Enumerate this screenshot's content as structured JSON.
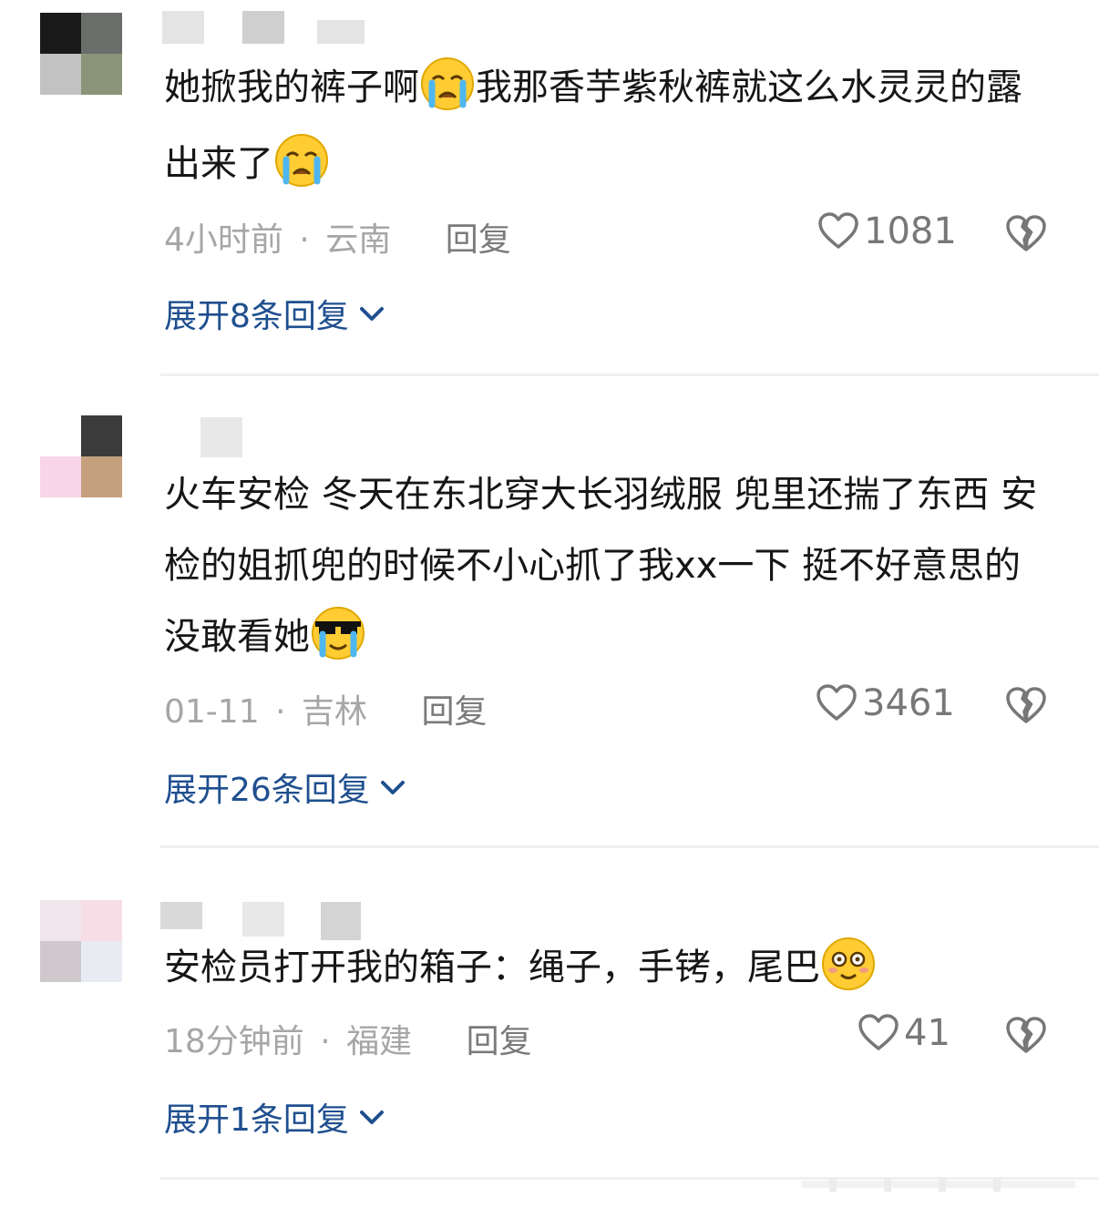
{
  "comments": [
    {
      "text_a": "她掀我的裤子啊",
      "text_b": "我那香芋紫秋裤就这么水灵灵的露出来了",
      "emoji_1": "loudly-crying-face",
      "emoji_2": "loudly-crying-face",
      "time": "4小时前",
      "sep": "·",
      "location": "云南",
      "reply_label": "回复",
      "likes": "1081",
      "expand_label": "展开8条回复"
    },
    {
      "text_a": "火车安检 冬天在东北穿大长羽绒服 兜里还揣了东西 安检的姐抓兜的时候不小心抓了我xx一下 挺不好意思的 没敢看她",
      "emoji_1": "sunglasses-crying-face",
      "time": "01-11",
      "sep": "·",
      "location": "吉林",
      "reply_label": "回复",
      "likes": "3461",
      "expand_label": "展开26条回复"
    },
    {
      "text_a": "安检员打开我的箱子：绳子，手铐，尾巴",
      "emoji_1": "flushed-smiling-face",
      "time": "18分钟前",
      "sep": "·",
      "location": "福建",
      "reply_label": "回复",
      "likes": "41",
      "expand_label": "展开1条回复"
    }
  ],
  "icons": {
    "like": "heart-outline-icon",
    "dislike": "broken-heart-icon",
    "expand": "chevron-down-icon"
  },
  "colors": {
    "link": "#1f4f8f",
    "meta": "#a6a6a6",
    "icon": "#777777"
  }
}
